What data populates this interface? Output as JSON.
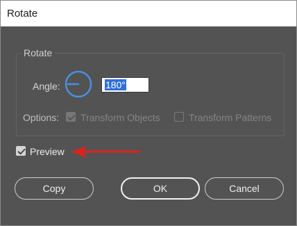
{
  "window": {
    "title": "Rotate"
  },
  "rotate_group": {
    "label": "Rotate",
    "angle_label": "Angle:",
    "angle_value": "180°",
    "options_label": "Options:",
    "transform_objects": {
      "label": "Transform Objects",
      "checked": true,
      "enabled": false
    },
    "transform_patterns": {
      "label": "Transform Patterns",
      "checked": false,
      "enabled": false
    }
  },
  "preview": {
    "label": "Preview",
    "checked": true
  },
  "buttons": {
    "copy": "Copy",
    "ok": "OK",
    "cancel": "Cancel"
  },
  "colors": {
    "dialog_bg": "#535353",
    "dial_accent": "#4a90e2",
    "selection": "#2f6fd6",
    "annotation_arrow": "#e0201a"
  },
  "icons": {
    "angle_dial": "angle-dial-icon",
    "checkmark": "checkmark-icon",
    "annotation": "red-arrow-icon"
  }
}
